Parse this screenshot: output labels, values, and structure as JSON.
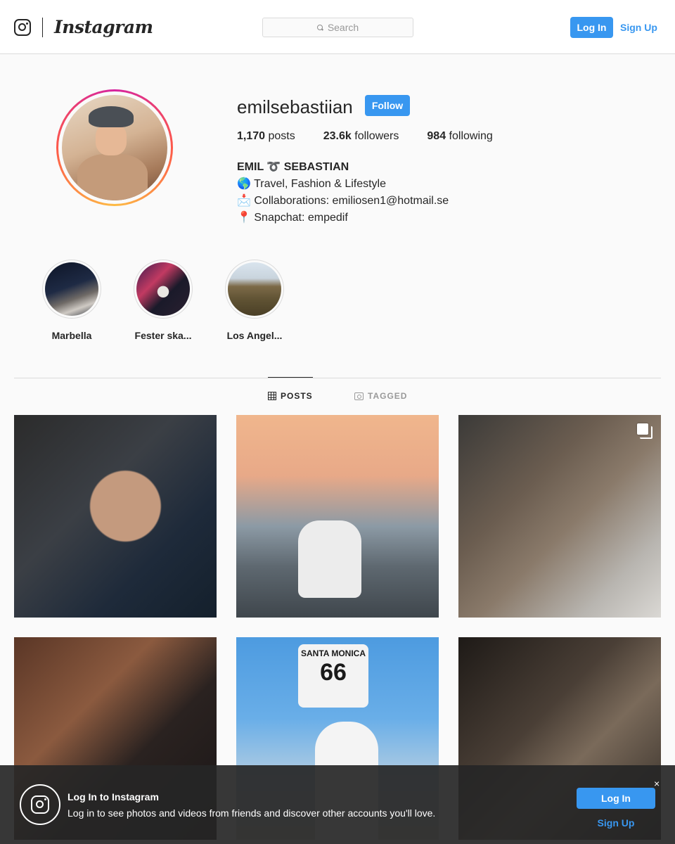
{
  "nav": {
    "logo_icon": "instagram-glyph-icon",
    "wordmark": "Instagram",
    "search_placeholder": "Search",
    "login_label": "Log In",
    "signup_label": "Sign Up"
  },
  "profile": {
    "username": "emilsebastiian",
    "follow_label": "Follow",
    "stats": {
      "posts_count": "1,170",
      "posts_label": "posts",
      "followers_count": "23.6k",
      "followers_label": "followers",
      "following_count": "984",
      "following_label": "following"
    },
    "bio": {
      "full_name": "EMIL ➰ SEBASTIAN",
      "line1": "🌎 Travel, Fashion & Lifestyle",
      "line2": "📩 Collaborations: emiliosen1@hotmail.se",
      "line3": "📍 Snapchat: empedif"
    }
  },
  "highlights": [
    {
      "label": "Marbella"
    },
    {
      "label": "Fester ska..."
    },
    {
      "label": "Los Angel..."
    }
  ],
  "tabs": [
    {
      "label": "POSTS",
      "icon": "grid-icon",
      "active": true
    },
    {
      "label": "TAGGED",
      "icon": "tagged-icon",
      "active": false
    }
  ],
  "posts": [
    {
      "sign_top": "",
      "sign_number": ""
    },
    {
      "sign_top": "",
      "sign_number": ""
    },
    {
      "sign_top": "",
      "sign_number": "",
      "multiple": true
    },
    {
      "sign_top": "",
      "sign_number": ""
    },
    {
      "sign_top": "SANTA MONICA",
      "sign_number": "66"
    },
    {
      "sign_top": "",
      "sign_number": ""
    }
  ],
  "banner": {
    "title": "Log In to Instagram",
    "text": "Log in to see photos and videos from friends and discover other accounts you'll love.",
    "close": "×",
    "login_label": "Log In",
    "signup_label": "Sign Up"
  },
  "colors": {
    "accent": "#3897f0",
    "text": "#262626",
    "border": "#dbdbdb",
    "background": "#fafafa"
  }
}
